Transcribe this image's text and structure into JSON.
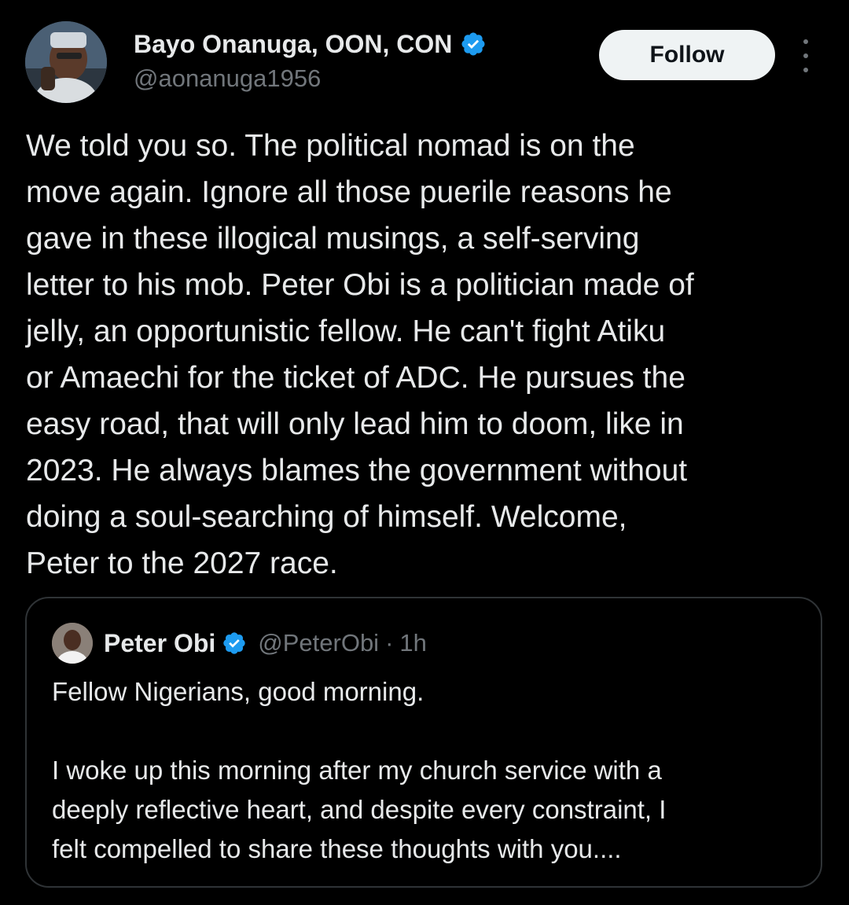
{
  "author": {
    "display_name": "Bayo Onanuga, OON, CON",
    "handle": "@aonanuga1956",
    "verified_icon": "verified-badge-icon"
  },
  "actions": {
    "follow_label": "Follow",
    "more_icon": "more-options-icon"
  },
  "tweet": {
    "text": "We told you so. The political nomad is on the\nmove again. Ignore all those puerile reasons he\ngave in these illogical musings, a self-serving\nletter to his mob. Peter Obi is a politician made of\njelly, an opportunistic fellow. He can't fight Atiku\nor Amaechi for the ticket of ADC. He pursues the\neasy road, that will only lead him to doom, like in\n2023. He always blames the government without\ndoing a soul-searching of himself. Welcome,\nPeter to the 2027 race."
  },
  "quoted_tweet": {
    "display_name": "Peter Obi",
    "handle": "@PeterObi",
    "separator": "·",
    "time": "1h",
    "paragraph1": "Fellow Nigerians, good morning.",
    "paragraph2_line1": "I woke up this morning after my church service with a",
    "paragraph2_line2": "deeply reflective heart, and despite every constraint, I",
    "paragraph2_line3": "felt compelled to share these thoughts with you...."
  },
  "colors": {
    "background": "#000000",
    "primary_text": "#e7e9ea",
    "secondary_text": "#71767b",
    "verified_blue": "#1d9bf0",
    "border": "#2f3336",
    "follow_bg": "#eff3f4"
  }
}
